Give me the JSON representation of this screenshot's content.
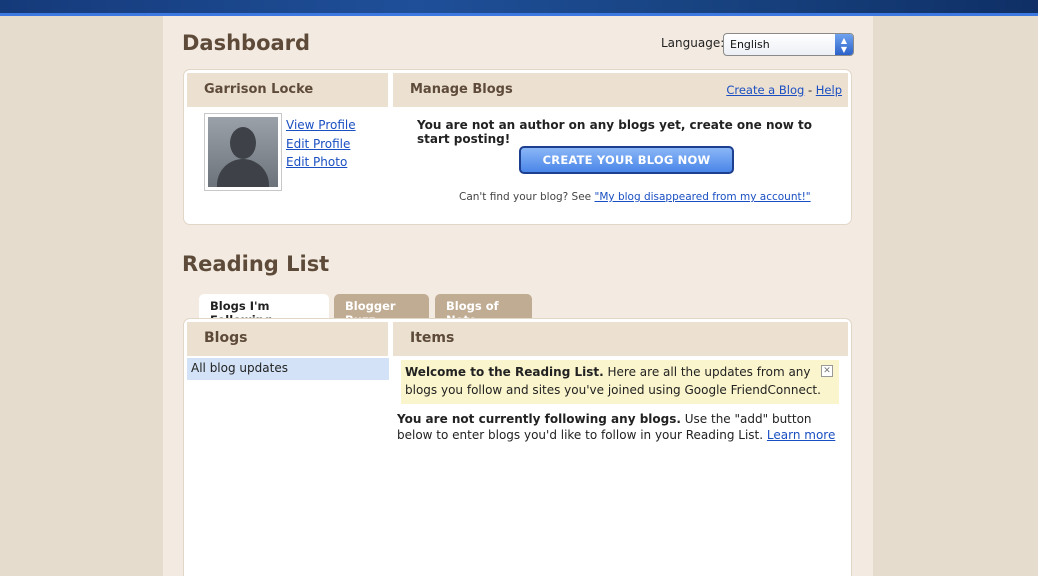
{
  "header": {
    "title": "Dashboard",
    "language_label": "Language:",
    "language_value": "English"
  },
  "profile": {
    "name": "Garrison Locke",
    "links": [
      "View Profile",
      "Edit Profile",
      "Edit Photo"
    ]
  },
  "manage": {
    "title": "Manage Blogs",
    "create_link": "Create a Blog",
    "separator": "-",
    "help_link": "Help",
    "message": "You are not an author on any blogs yet, create one now to start posting!",
    "create_button": "CREATE YOUR BLOG NOW",
    "cant_find_text": "Can't find your blog? See",
    "cant_find_link": "\"My blog disappeared from my account!\""
  },
  "reading_list": {
    "title": "Reading List",
    "tabs": [
      "Blogs I'm Following",
      "Blogger Buzz",
      "Blogs of Note"
    ],
    "blogs_header": "Blogs",
    "items_header": "Items",
    "all_updates": "All blog updates",
    "welcome_bold": "Welcome to the Reading List.",
    "welcome_text": "Here are all the updates from any blogs you follow and sites you've joined using Google FriendConnect.",
    "following_bold": "You are not currently following any blogs.",
    "following_text": "Use the \"add\" button below to enter blogs you'd like to follow in your Reading List.",
    "learn_more": "Learn more"
  }
}
